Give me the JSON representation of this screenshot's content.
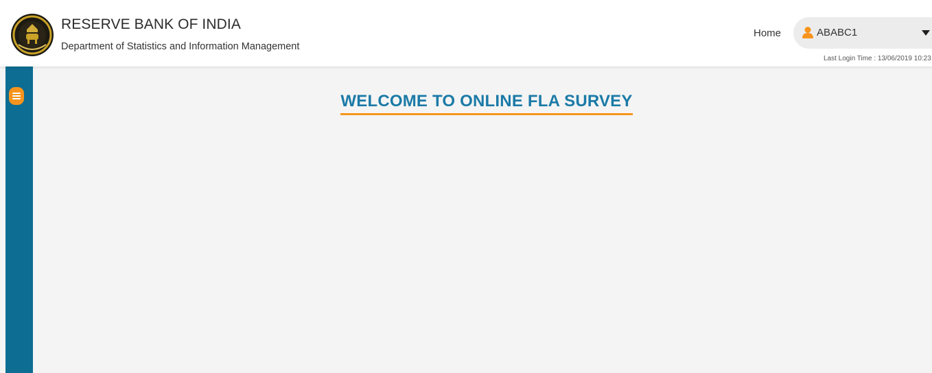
{
  "header": {
    "org_title": "RESERVE BANK OF INDIA",
    "org_subtitle": "Department of Statistics and Information Management",
    "logo_icon": "rbi-emblem-icon"
  },
  "nav": {
    "home_label": "Home",
    "user_icon": "user-icon",
    "username": "ABABC1",
    "dropdown_icon": "caret-down-icon",
    "last_login": "Last Login Time : 13/06/2019 10:23"
  },
  "sidebar": {
    "menu_icon": "hamburger-menu-icon"
  },
  "main": {
    "welcome_title": "WELCOME TO ONLINE FLA SURVEY"
  },
  "colors": {
    "brand_blue": "#0d6d92",
    "title_blue": "#1b7aa7",
    "accent_orange": "#f7941d",
    "background": "#f4f4f4"
  }
}
